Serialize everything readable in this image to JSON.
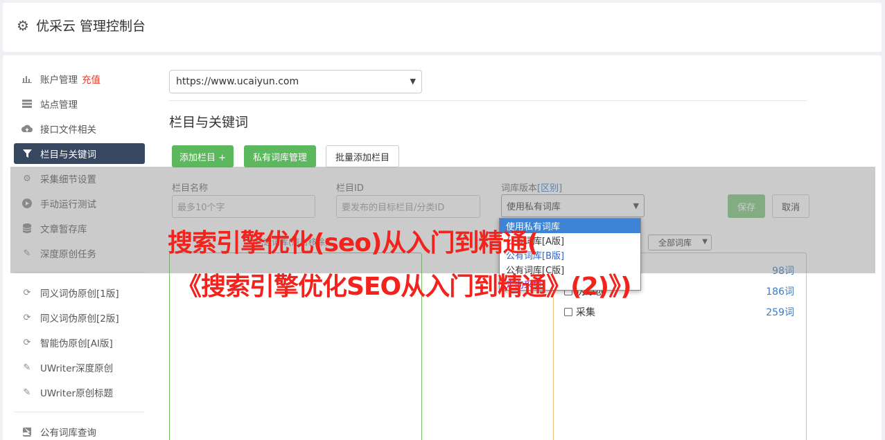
{
  "header": {
    "title": "优采云 管理控制台",
    "icon": "gear-icon"
  },
  "sidebar": {
    "items": [
      {
        "label": "账户管理",
        "extra": "充值",
        "icon": "bar-chart-icon"
      },
      {
        "label": "站点管理",
        "icon": "server-icon"
      },
      {
        "label": "接口文件相关",
        "icon": "cloud-upload-icon"
      },
      {
        "label": "栏目与关键词",
        "icon": "filter-icon",
        "active": true
      },
      {
        "label": "采集细节设置",
        "icon": "cogs-icon"
      },
      {
        "label": "手动运行测试",
        "icon": "play-circle-icon"
      },
      {
        "label": "文章暂存库",
        "icon": "database-icon"
      },
      {
        "label": "深度原创任务",
        "icon": "edit-icon"
      },
      {
        "label": "同义词伪原创[1版]",
        "icon": "refresh-icon"
      },
      {
        "label": "同义词伪原创[2版]",
        "icon": "refresh-icon"
      },
      {
        "label": "智能伪原创[AI版]",
        "icon": "refresh-icon"
      },
      {
        "label": "UWriter深度原创",
        "icon": "edit-icon"
      },
      {
        "label": "UWriter原创标题",
        "icon": "edit-icon"
      },
      {
        "label": "公有词库查询",
        "icon": "book-icon"
      }
    ]
  },
  "main": {
    "site_select": "https://www.ucaiyun.com",
    "section_title": "栏目与关键词",
    "buttons": {
      "add_column": "添加栏目 +",
      "private_lib": "私有词库管理",
      "batch_add": "批量添加栏目",
      "save": "保存",
      "cancel": "取消"
    },
    "form": {
      "name_label": "栏目名称",
      "name_placeholder": "最多10个字",
      "id_label": "栏目ID",
      "id_placeholder": "要发布的目标栏目/分类ID",
      "version_label": "词库版本",
      "version_label_link": "[区别]",
      "version_value": "使用私有词库"
    },
    "dropdown_options": [
      "使用私有词库",
      "公有词库[A版]",
      "公有词库[B版]",
      "公有词库[C版]",
      "定向采集"
    ],
    "panel_caption": "已选词库(点击移除)",
    "filter_select": "全部词库",
    "libraries": [
      {
        "name": "",
        "count": "98词"
      },
      {
        "name": "伪原创",
        "count": "186词"
      },
      {
        "name": "采集",
        "count": "259词"
      }
    ]
  },
  "watermark": {
    "line1": "搜索引擎优化(seo)从入门到精通(",
    "line2": "《搜索引擎优化SEO从入门到精通》(2)》)"
  }
}
